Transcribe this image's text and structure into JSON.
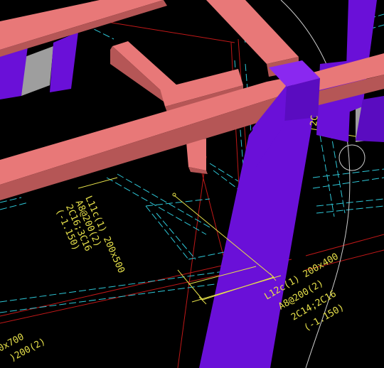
{
  "colors": {
    "background": "#000000",
    "beam": "#e87878",
    "beam_dark": "#b55656",
    "column": "#6a10d8",
    "column_top": "#8a28f0",
    "wall": "#9e9e9e",
    "red_line": "#c01818",
    "cyan_line": "#2ec8d8",
    "annotation": "#e6e04a",
    "white_line": "#cccccc"
  },
  "annotations": {
    "beam_l11": {
      "name": "L11c(1) 200x500",
      "stirrup": "A8@200(2)",
      "rebar": "2C16;3C16",
      "elevation": "(-1.150)"
    },
    "beam_l12": {
      "name": "L12c(1) 200x400",
      "stirrup": "A8@200(2)",
      "rebar": "2C14;2C16",
      "elevation": "(-1.150)"
    },
    "beam_partial": {
      "name": "0x700",
      "stirrup": ")200(2)"
    },
    "column_partial": "2C"
  }
}
